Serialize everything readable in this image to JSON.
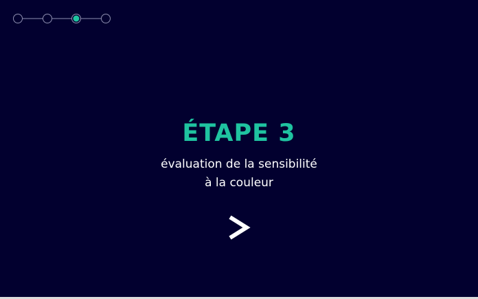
{
  "progress": {
    "total_steps": 4,
    "current_step": 3
  },
  "colors": {
    "background": "#02002f",
    "accent": "#1fc3a0",
    "text": "#ffffff",
    "inactive_step": "#8f8fb0"
  },
  "main": {
    "title": "ÉTAPE 3",
    "subtitle_line1": "évaluation de la sensibilité",
    "subtitle_line2": "à la couleur",
    "next_icon": "chevron-right-icon"
  }
}
